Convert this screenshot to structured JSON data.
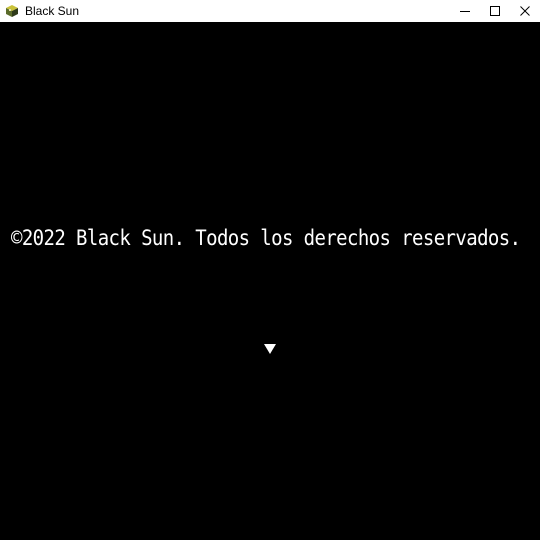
{
  "window": {
    "title": "Black Sun",
    "icon": "app-cube-icon",
    "controls": [
      "minimize-icon",
      "maximize-icon",
      "close-icon"
    ]
  },
  "screen": {
    "background": "#000000",
    "text_color": "#ffffff",
    "copyright_text": "©2022 Black Sun. Todos los derechos reservados.",
    "advance_indicator": "triangle-down-icon"
  }
}
